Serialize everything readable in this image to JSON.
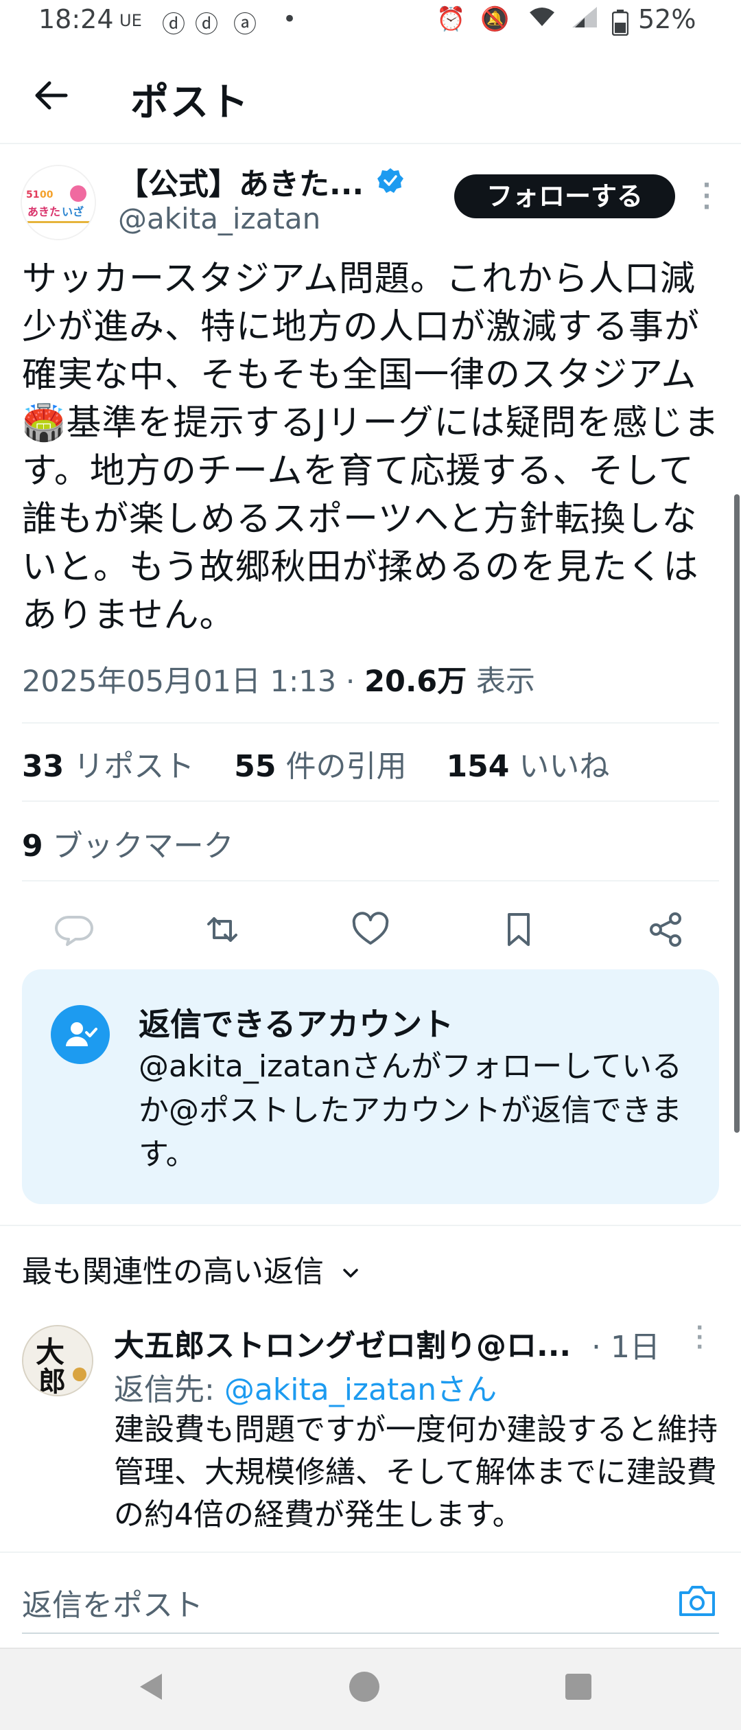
{
  "status_bar": {
    "time": "18:24",
    "carrier": "UE",
    "battery": "52%"
  },
  "header": {
    "title": "ポスト"
  },
  "author": {
    "name": "【公式】あきた...",
    "handle": "@akita_izatan",
    "follow_label": "フォローする"
  },
  "tweet": {
    "text": "サッカースタジアム問題。これから人口減少が進み、特に地方の人口が激減する事が確実な中、そもそも全国一律のスタジアム🏟️基準を提示するJリーグには疑問を感じます。地方のチームを育て応援する、そして誰もが楽しめるスポーツへと方針転換しないと。もう故郷秋田が揉めるのを見たくはありません。",
    "date": "2025年05月01日 1:13 · ",
    "views": "20.6万",
    "views_label": " 表示"
  },
  "stats": {
    "reposts": "33",
    "reposts_label": " リポスト",
    "quotes": "55",
    "quotes_label": " 件の引用",
    "likes": "154",
    "likes_label": " いいね",
    "bookmarks": "9",
    "bookmarks_label": " ブックマーク"
  },
  "reply_restriction": {
    "title": "返信できるアカウント",
    "body": "@akita_izatanさんがフォローしているか@ポストしたアカウントが返信できます。"
  },
  "sort": {
    "label": "最も関連性の高い返信"
  },
  "reply": {
    "name": "大五郎ストロングゼロ割り@ロ...",
    "time": "· 1日",
    "reply_to_prefix": "返信先: ",
    "reply_to_handle": "@akita_izatanさん",
    "text": "建設費も問題ですが一度何か建設すると維持管理、大規模修繕、そして解体までに建設費の約4倍の経費が発生します。"
  },
  "composer": {
    "placeholder": "返信をポスト"
  },
  "colors": {
    "accent": "#1d9bf0",
    "text_primary": "#0f1419",
    "text_secondary": "#536471"
  }
}
